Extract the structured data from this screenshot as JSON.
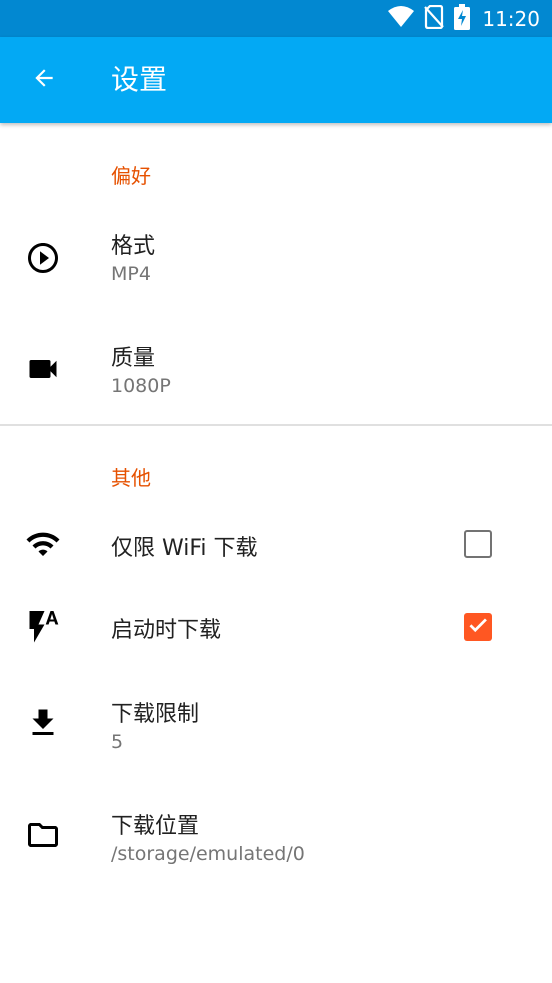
{
  "status_bar": {
    "time": "11:20",
    "icons": [
      "wifi-icon",
      "no-sim-icon",
      "battery-charging-icon"
    ]
  },
  "app_bar": {
    "title": "设置",
    "back_icon": "arrow-back-icon"
  },
  "sections": {
    "preferences": {
      "header": "偏好",
      "items": [
        {
          "title": "格式",
          "summary": "MP4",
          "icon": "play-circle-icon"
        },
        {
          "title": "质量",
          "summary": "1080P",
          "icon": "videocam-icon"
        }
      ]
    },
    "other": {
      "header": "其他",
      "items": [
        {
          "title": "仅限 WiFi 下载",
          "icon": "wifi-icon",
          "checked": false
        },
        {
          "title": "启动时下载",
          "icon": "flash-auto-icon",
          "checked": true
        },
        {
          "title": "下载限制",
          "summary": "5",
          "icon": "download-icon"
        },
        {
          "title": "下载位置",
          "summary": "/storage/emulated/0",
          "icon": "folder-icon"
        }
      ]
    }
  },
  "colors": {
    "status_bar": "#0288D1",
    "app_bar": "#03A9F4",
    "section_header": "#E65100",
    "checkbox_checked": "#FF5722"
  }
}
